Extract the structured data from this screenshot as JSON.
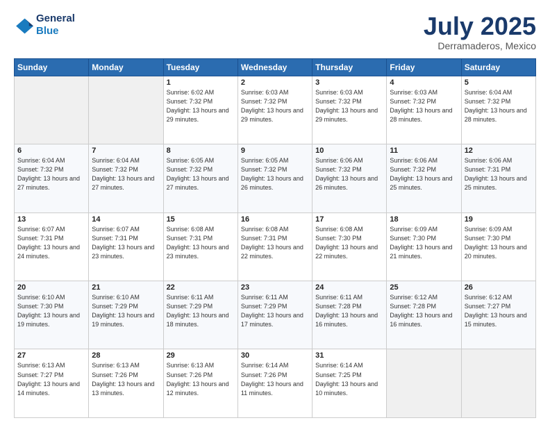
{
  "header": {
    "logo_line1": "General",
    "logo_line2": "Blue",
    "month": "July 2025",
    "location": "Derramaderos, Mexico"
  },
  "weekdays": [
    "Sunday",
    "Monday",
    "Tuesday",
    "Wednesday",
    "Thursday",
    "Friday",
    "Saturday"
  ],
  "weeks": [
    [
      {
        "day": "",
        "info": ""
      },
      {
        "day": "",
        "info": ""
      },
      {
        "day": "1",
        "info": "Sunrise: 6:02 AM\nSunset: 7:32 PM\nDaylight: 13 hours and 29 minutes."
      },
      {
        "day": "2",
        "info": "Sunrise: 6:03 AM\nSunset: 7:32 PM\nDaylight: 13 hours and 29 minutes."
      },
      {
        "day": "3",
        "info": "Sunrise: 6:03 AM\nSunset: 7:32 PM\nDaylight: 13 hours and 29 minutes."
      },
      {
        "day": "4",
        "info": "Sunrise: 6:03 AM\nSunset: 7:32 PM\nDaylight: 13 hours and 28 minutes."
      },
      {
        "day": "5",
        "info": "Sunrise: 6:04 AM\nSunset: 7:32 PM\nDaylight: 13 hours and 28 minutes."
      }
    ],
    [
      {
        "day": "6",
        "info": "Sunrise: 6:04 AM\nSunset: 7:32 PM\nDaylight: 13 hours and 27 minutes."
      },
      {
        "day": "7",
        "info": "Sunrise: 6:04 AM\nSunset: 7:32 PM\nDaylight: 13 hours and 27 minutes."
      },
      {
        "day": "8",
        "info": "Sunrise: 6:05 AM\nSunset: 7:32 PM\nDaylight: 13 hours and 27 minutes."
      },
      {
        "day": "9",
        "info": "Sunrise: 6:05 AM\nSunset: 7:32 PM\nDaylight: 13 hours and 26 minutes."
      },
      {
        "day": "10",
        "info": "Sunrise: 6:06 AM\nSunset: 7:32 PM\nDaylight: 13 hours and 26 minutes."
      },
      {
        "day": "11",
        "info": "Sunrise: 6:06 AM\nSunset: 7:32 PM\nDaylight: 13 hours and 25 minutes."
      },
      {
        "day": "12",
        "info": "Sunrise: 6:06 AM\nSunset: 7:31 PM\nDaylight: 13 hours and 25 minutes."
      }
    ],
    [
      {
        "day": "13",
        "info": "Sunrise: 6:07 AM\nSunset: 7:31 PM\nDaylight: 13 hours and 24 minutes."
      },
      {
        "day": "14",
        "info": "Sunrise: 6:07 AM\nSunset: 7:31 PM\nDaylight: 13 hours and 23 minutes."
      },
      {
        "day": "15",
        "info": "Sunrise: 6:08 AM\nSunset: 7:31 PM\nDaylight: 13 hours and 23 minutes."
      },
      {
        "day": "16",
        "info": "Sunrise: 6:08 AM\nSunset: 7:31 PM\nDaylight: 13 hours and 22 minutes."
      },
      {
        "day": "17",
        "info": "Sunrise: 6:08 AM\nSunset: 7:30 PM\nDaylight: 13 hours and 22 minutes."
      },
      {
        "day": "18",
        "info": "Sunrise: 6:09 AM\nSunset: 7:30 PM\nDaylight: 13 hours and 21 minutes."
      },
      {
        "day": "19",
        "info": "Sunrise: 6:09 AM\nSunset: 7:30 PM\nDaylight: 13 hours and 20 minutes."
      }
    ],
    [
      {
        "day": "20",
        "info": "Sunrise: 6:10 AM\nSunset: 7:30 PM\nDaylight: 13 hours and 19 minutes."
      },
      {
        "day": "21",
        "info": "Sunrise: 6:10 AM\nSunset: 7:29 PM\nDaylight: 13 hours and 19 minutes."
      },
      {
        "day": "22",
        "info": "Sunrise: 6:11 AM\nSunset: 7:29 PM\nDaylight: 13 hours and 18 minutes."
      },
      {
        "day": "23",
        "info": "Sunrise: 6:11 AM\nSunset: 7:29 PM\nDaylight: 13 hours and 17 minutes."
      },
      {
        "day": "24",
        "info": "Sunrise: 6:11 AM\nSunset: 7:28 PM\nDaylight: 13 hours and 16 minutes."
      },
      {
        "day": "25",
        "info": "Sunrise: 6:12 AM\nSunset: 7:28 PM\nDaylight: 13 hours and 16 minutes."
      },
      {
        "day": "26",
        "info": "Sunrise: 6:12 AM\nSunset: 7:27 PM\nDaylight: 13 hours and 15 minutes."
      }
    ],
    [
      {
        "day": "27",
        "info": "Sunrise: 6:13 AM\nSunset: 7:27 PM\nDaylight: 13 hours and 14 minutes."
      },
      {
        "day": "28",
        "info": "Sunrise: 6:13 AM\nSunset: 7:26 PM\nDaylight: 13 hours and 13 minutes."
      },
      {
        "day": "29",
        "info": "Sunrise: 6:13 AM\nSunset: 7:26 PM\nDaylight: 13 hours and 12 minutes."
      },
      {
        "day": "30",
        "info": "Sunrise: 6:14 AM\nSunset: 7:26 PM\nDaylight: 13 hours and 11 minutes."
      },
      {
        "day": "31",
        "info": "Sunrise: 6:14 AM\nSunset: 7:25 PM\nDaylight: 13 hours and 10 minutes."
      },
      {
        "day": "",
        "info": ""
      },
      {
        "day": "",
        "info": ""
      }
    ]
  ]
}
